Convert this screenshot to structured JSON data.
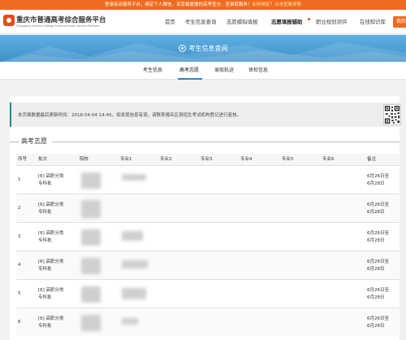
{
  "banner": {
    "text": "登录综合服务平台，绑定个人微信，享受最便捷的高考查分、查录取服务！",
    "link": "如何绑定？点击查看详情"
  },
  "header": {
    "brand": "重庆市普通高考综合服务平台",
    "brand_sub": "Chongqing General College Entrance Exam Service Platform",
    "nav": [
      {
        "label": "首页"
      },
      {
        "label": "考生信息查询"
      },
      {
        "label": "志愿模拟填报"
      },
      {
        "label": "志愿填报辅助"
      },
      {
        "label": "职业规划测评"
      },
      {
        "label": "在线知识库"
      }
    ],
    "right_button": "我的"
  },
  "hero": {
    "title": "考生信息查阅"
  },
  "tabs": [
    {
      "label": "考生信息"
    },
    {
      "label": "高考志愿"
    },
    {
      "label": "录取轨迹"
    },
    {
      "label": "体检信息"
    }
  ],
  "notice": "本页面数据最后更新时间：2018-04-04 14:45。如发现信息有误，请联系报名区县招生考试机构登记进行复核。",
  "section": {
    "title": "高考志愿"
  },
  "table": {
    "headers": [
      "序号",
      "批次",
      "院校",
      "专业1",
      "专业2",
      "专业3",
      "专业4",
      "专业5",
      "专业6",
      "备注"
    ],
    "rows": [
      {
        "index": "1",
        "batch_line1": "[6] 高职分类",
        "batch_line2": "专科批",
        "note_line1": "6月26日至",
        "note_line2": "6月28日"
      },
      {
        "index": "2",
        "batch_line1": "[6] 高职分类",
        "batch_line2": "专科批",
        "note_line1": "6月26日至",
        "note_line2": "6月28日"
      },
      {
        "index": "3",
        "batch_line1": "[6] 高职分类",
        "batch_line2": "专科批",
        "note_line1": "6月26日至",
        "note_line2": "6月28日"
      },
      {
        "index": "4",
        "batch_line1": "[6] 高职分类",
        "batch_line2": "专科批",
        "note_line1": "6月26日至",
        "note_line2": "6月28日"
      },
      {
        "index": "5",
        "batch_line1": "[6] 高职分类",
        "batch_line2": "专科批",
        "note_line1": "6月26日至",
        "note_line2": "6月28日"
      },
      {
        "index": "6",
        "batch_line1": "[6] 高职分类",
        "batch_line2": "专科批",
        "note_line1": "6月26日至",
        "note_line2": "6月28日"
      }
    ]
  },
  "colors": {
    "accent": "#ef6b20",
    "hero": "#4a9fd6",
    "notice_border": "#1f8a8a",
    "tab_active": "#2f86c8"
  }
}
